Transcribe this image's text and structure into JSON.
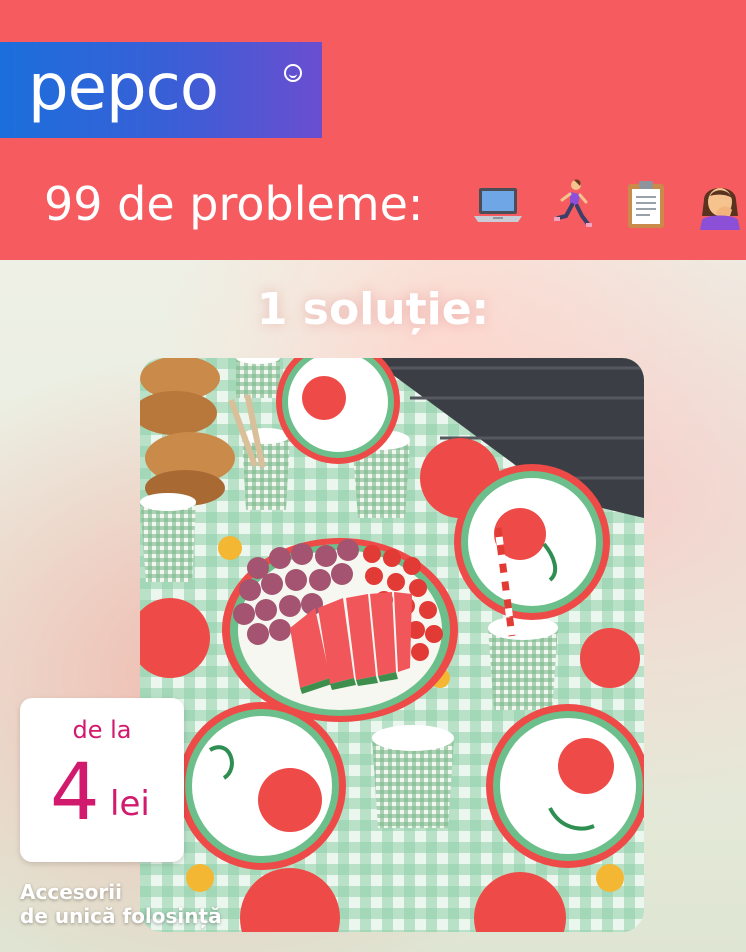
{
  "brand": {
    "logo": "pepco",
    "colors": {
      "band": "#f65c5f",
      "logo_bg_start": "#1b6fdc",
      "logo_bg_end": "#6a4ed0",
      "price": "#d11a6d"
    }
  },
  "headline": "99 de probleme:",
  "emojis": [
    "laptop-icon",
    "running-woman-icon",
    "clipboard-icon",
    "face-palm-icon"
  ],
  "solution": "1 soluție:",
  "price": {
    "prefix": "de la",
    "amount": "4",
    "unit": "lei"
  },
  "caption": {
    "line1": "Accesorii",
    "line2": "de unică folosință"
  }
}
